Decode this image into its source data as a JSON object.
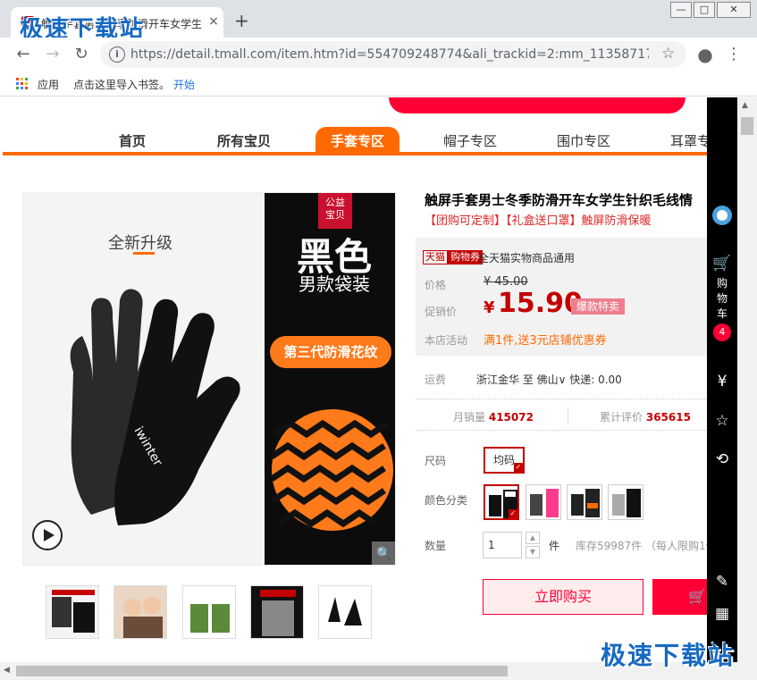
{
  "browser": {
    "tab_title": "触屏手套男士冬季防滑开车女学生",
    "tab_close": "×",
    "new_tab": "+",
    "url": "https://detail.tmall.com/item.htm?id=554709248774&ali_trackid=2:mm_113587172_...",
    "window_controls": [
      "—",
      "□",
      "✕"
    ],
    "bookmarks": {
      "apps": "应用",
      "import_hint": "点击这里导入书签。",
      "start": "开始"
    },
    "icons": [
      "back-icon",
      "forward-icon",
      "reload-icon",
      "info-icon",
      "star-icon",
      "account-icon",
      "menu-icon"
    ]
  },
  "watermark": {
    "top": "极速下载站",
    "bottom": "极速下载站"
  },
  "nav": {
    "items": [
      "首页",
      "所有宝贝",
      "手套专区",
      "帽子专区",
      "围巾专区",
      "耳罩专"
    ],
    "active_index": 2
  },
  "gallery": {
    "upgrade_text": "全新升级",
    "badge": [
      "公益",
      "宝贝"
    ],
    "black_text": "黑色",
    "bag_text": "男款袋装",
    "gen3_text": "第三代防滑花纹",
    "brand_text": "iwinter",
    "thumbnails": 5
  },
  "product": {
    "title": "触屏手套男士冬季防滑开车女学生针织毛线情",
    "subtitle": "【团购可定制】【礼盒送口罩】触屏防滑保暖",
    "tmall_tag": "天猫",
    "coupon_tag": "购物券",
    "coupon_text": "全天猫实物商品通用",
    "price_label": "价格",
    "old_price": "¥ 45.00",
    "promo_label": "促销价",
    "currency": "¥",
    "new_price": "15.90",
    "hot_tag": "爆款特卖",
    "activity_label": "本店活动",
    "activity_text": "满1件,送3元店铺优惠券",
    "shipping_label": "运费",
    "shipping_text": "浙江金华 至 佛山∨ 快递: 0.00",
    "monthly_sales_label": "月销量",
    "monthly_sales": "415072",
    "reviews_label": "累计评价",
    "reviews": "365615",
    "size_label": "尺码",
    "size_value": "均码",
    "color_label": "颜色分类",
    "color_count": 4,
    "quantity_label": "数量",
    "quantity_value": "1",
    "quantity_unit": "件",
    "stock_text": "库存59987件 （每人限购1件",
    "buy_now": "立即购买",
    "add_cart": "加"
  },
  "sidebar": {
    "cart_label": "购物车",
    "cart_count": "4",
    "icons": [
      "avatar-icon",
      "cart-icon",
      "yen-icon",
      "star-icon",
      "history-icon",
      "edit-icon",
      "qrcode-icon"
    ]
  },
  "colors": {
    "brand_red": "#ff0036",
    "tmall_red": "#c40000",
    "orange": "#ff6a00"
  }
}
